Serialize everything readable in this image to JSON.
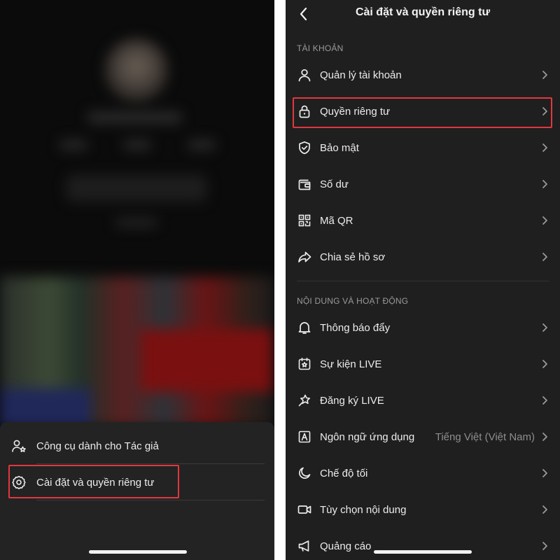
{
  "left_panel": {
    "sheet_items": [
      {
        "label": "Công cụ dành cho Tác giả",
        "icon": "creator-tools-icon"
      },
      {
        "label": "Cài đặt và quyền riêng tư",
        "icon": "gear-icon"
      }
    ],
    "highlighted_item": "Cài đặt và quyền riêng tư"
  },
  "right_panel": {
    "title": "Cài đặt và quyền riêng tư",
    "sections": [
      {
        "title": "TÀI KHOẢN",
        "items": [
          {
            "label": "Quản lý tài khoản",
            "icon": "person-icon"
          },
          {
            "label": "Quyền riêng tư",
            "icon": "lock-icon"
          },
          {
            "label": "Bảo mật",
            "icon": "shield-icon"
          },
          {
            "label": "Số dư",
            "icon": "wallet-icon"
          },
          {
            "label": "Mã QR",
            "icon": "qr-code-icon"
          },
          {
            "label": "Chia sẻ hồ sơ",
            "icon": "share-icon"
          }
        ]
      },
      {
        "title": "NỘI DUNG VÀ HOẠT ĐỘNG",
        "items": [
          {
            "label": "Thông báo đẩy",
            "icon": "bell-icon"
          },
          {
            "label": "Sự kiện LIVE",
            "icon": "calendar-star-icon"
          },
          {
            "label": "Đăng ký LIVE",
            "icon": "star-badge-icon"
          },
          {
            "label": "Ngôn ngữ ứng dụng",
            "value": "Tiếng Việt (Việt Nam)",
            "icon": "language-icon"
          },
          {
            "label": "Chế độ tối",
            "icon": "moon-icon"
          },
          {
            "label": "Tùy chọn nội dung",
            "icon": "video-icon"
          },
          {
            "label": "Quảng cáo",
            "icon": "megaphone-icon"
          }
        ]
      }
    ],
    "highlighted_item": "Quyền riêng tư"
  },
  "colors": {
    "highlight": "#e0383e",
    "left_background": "#0b0b0b",
    "sheet_background": "#232323",
    "right_background": "#1f1f1f",
    "text_primary": "#ececec",
    "text_secondary": "#9a9a9a"
  }
}
